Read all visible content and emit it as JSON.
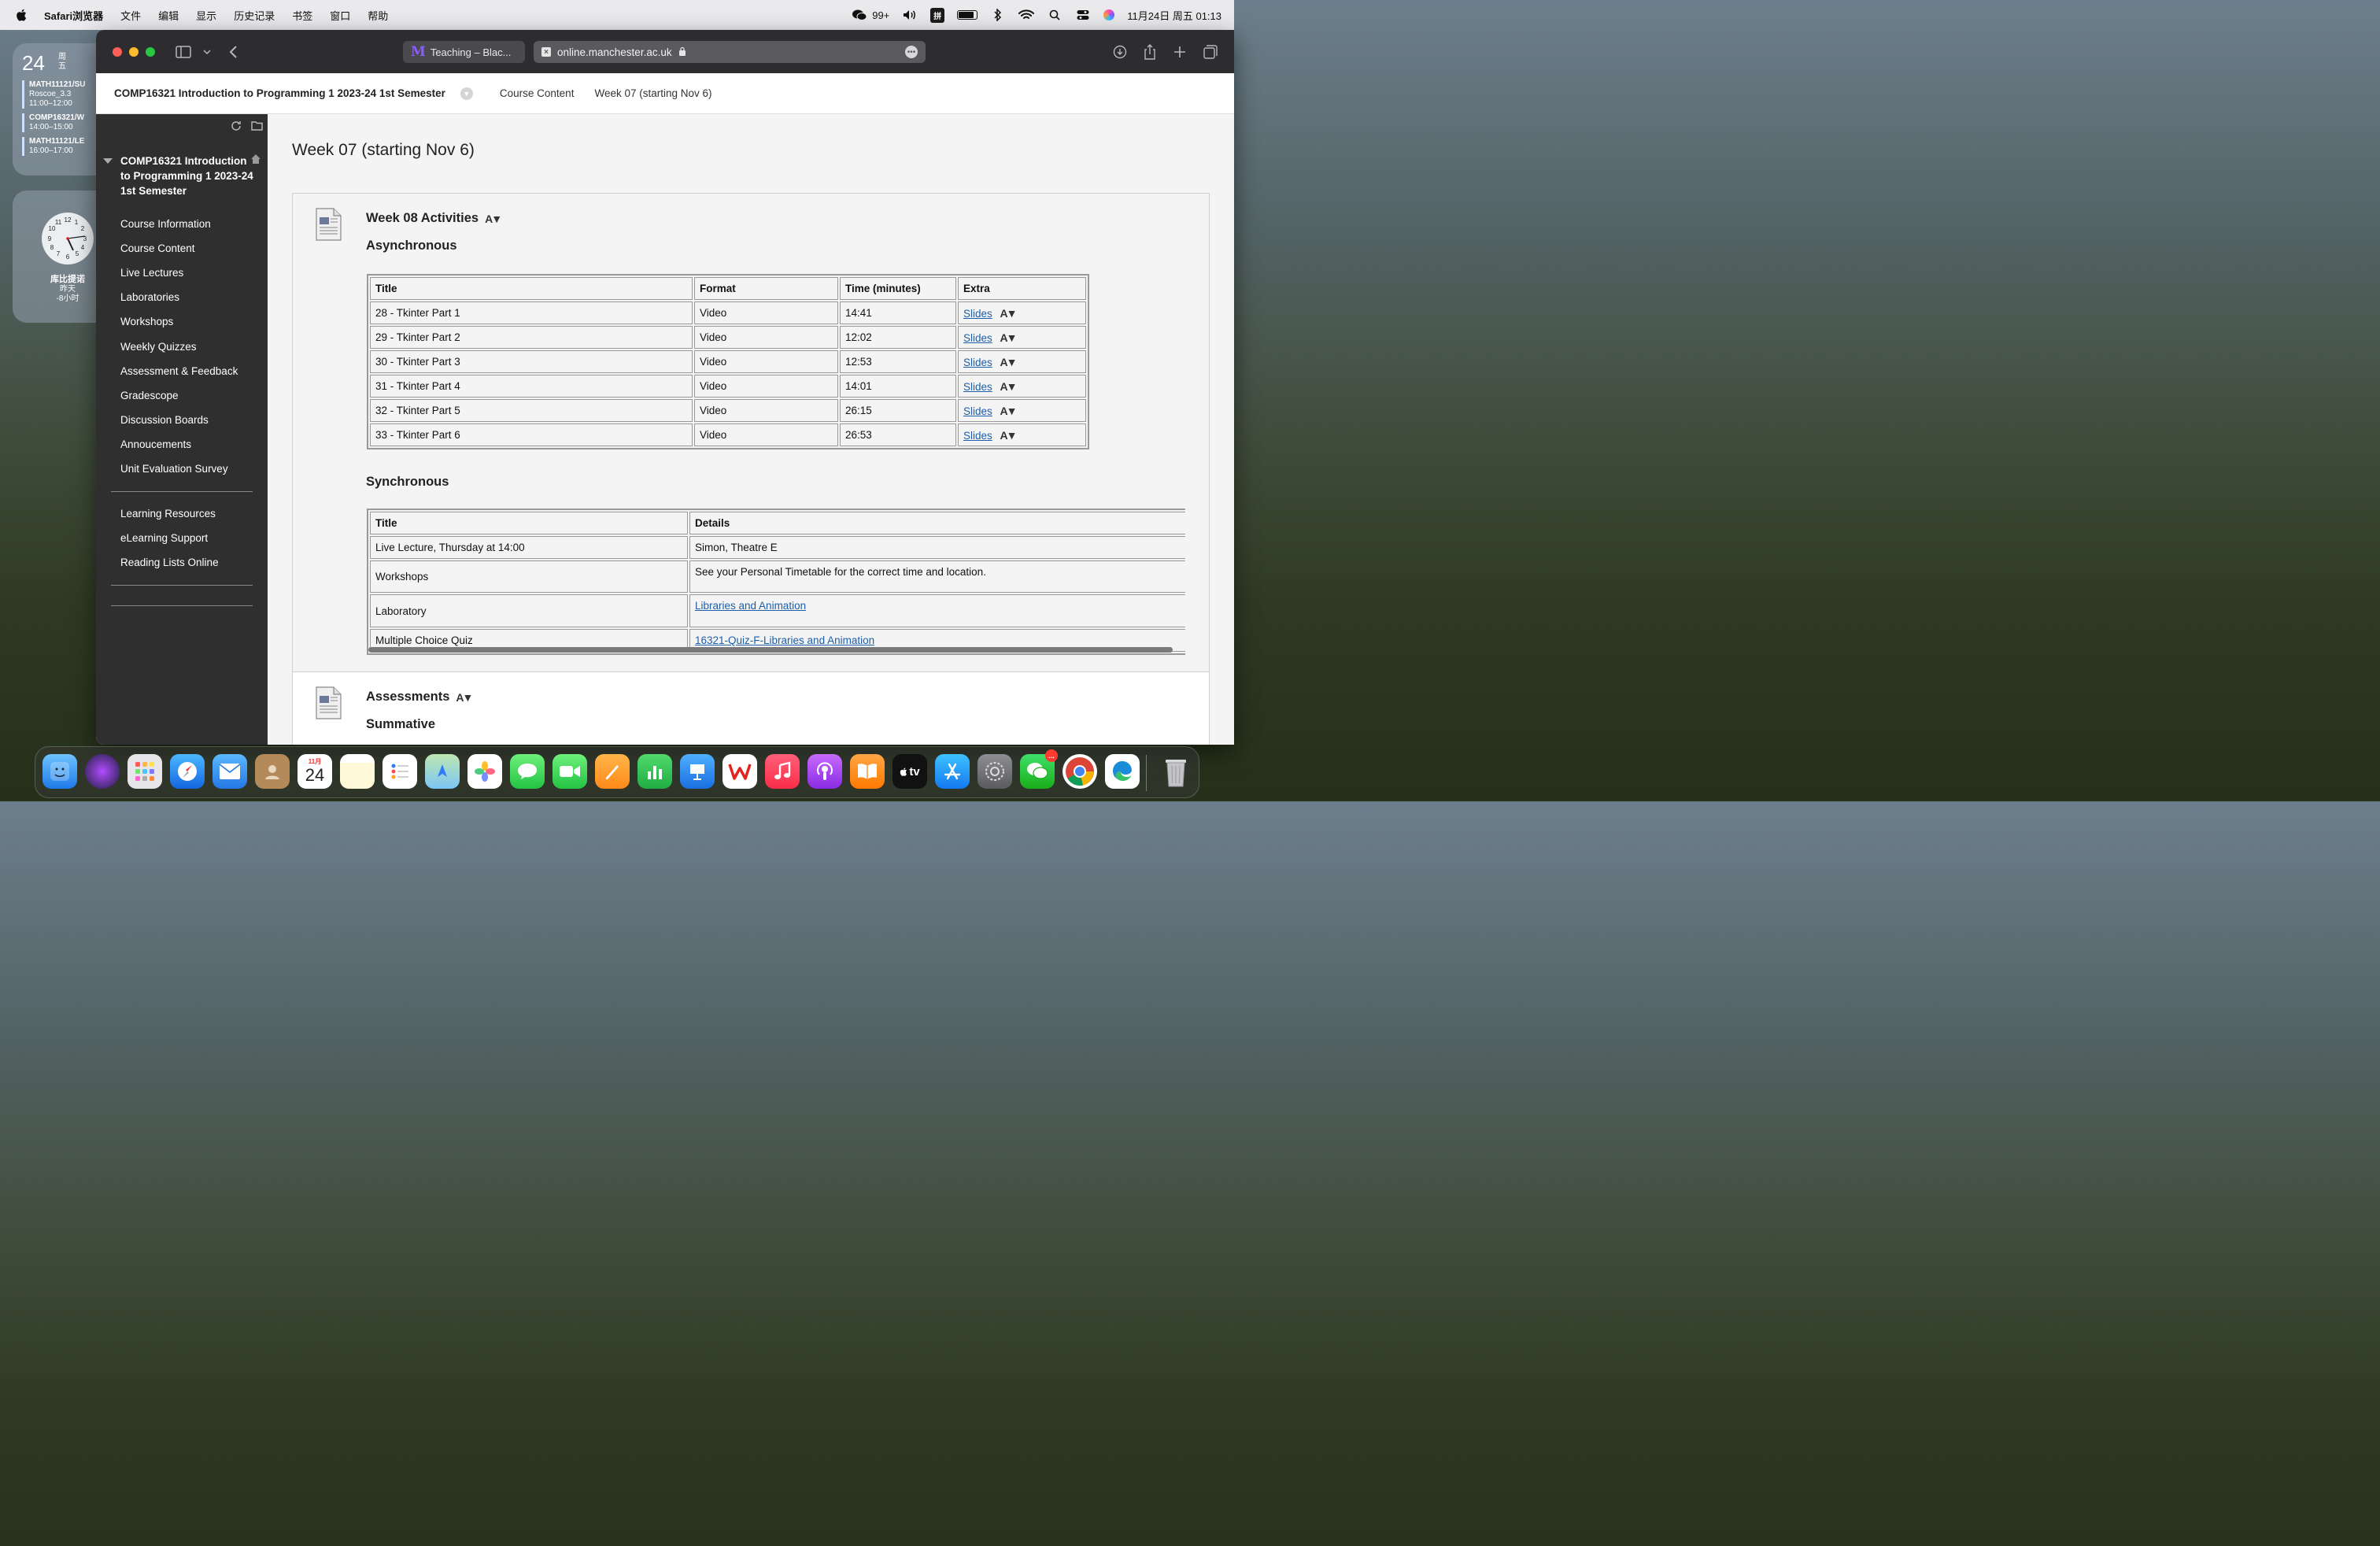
{
  "menubar": {
    "app_name": "Safari浏览器",
    "menus": [
      "文件",
      "编辑",
      "显示",
      "历史记录",
      "书签",
      "窗口",
      "帮助"
    ],
    "wechat_count": "99+",
    "ime_label": "拼",
    "datetime": "11月24日 周五 01:13"
  },
  "calendar_widget": {
    "day": "24",
    "weekday": "周五",
    "events": [
      {
        "title": "MATH11121/SU",
        "location": "Roscoe_3.3",
        "time": "11:00–12:00"
      },
      {
        "title": "COMP16321/W",
        "location": "",
        "time": "14:00–15:00"
      },
      {
        "title": "MATH11121/LE",
        "location": "",
        "time": "16:00–17:00"
      }
    ]
  },
  "clock_widget": {
    "city": "库比提诺",
    "day": "昨天",
    "offset": "-8小时",
    "numbers": [
      "12",
      "1",
      "2",
      "3",
      "4",
      "5",
      "6",
      "7",
      "8",
      "9",
      "10",
      "11"
    ]
  },
  "browser": {
    "tab_title": "Teaching – Blac...",
    "address": "online.manchester.ac.uk"
  },
  "header": {
    "course_title": "COMP16321 Introduction to Programming 1 2023-24 1st Semester",
    "breadcrumb_1": "Course Content",
    "breadcrumb_2": "Week 07 (starting Nov 6)"
  },
  "sidebar": {
    "course_name": "COMP16321 Introduction to Programming 1 2023-24 1st Semester",
    "items": [
      {
        "label": "Course Information"
      },
      {
        "label": "Course Content"
      },
      {
        "label": "Live Lectures"
      },
      {
        "label": "Laboratories"
      },
      {
        "label": "Workshops"
      },
      {
        "label": "Weekly Quizzes"
      },
      {
        "label": "Assessment & Feedback"
      },
      {
        "label": "Gradescope"
      },
      {
        "label": "Discussion Boards"
      },
      {
        "label": "Annoucements"
      },
      {
        "label": "Unit Evaluation Survey"
      }
    ],
    "secondary_items": [
      {
        "label": "Learning Resources"
      },
      {
        "label": "eLearning Support"
      },
      {
        "label": "Reading Lists Online"
      }
    ]
  },
  "main": {
    "page_title": "Week 07 (starting Nov 6)",
    "item1": {
      "title": "Week 08 Activities",
      "async_heading": "Asynchronous",
      "async_columns": [
        "Title",
        "Format",
        "Time (minutes)",
        "Extra"
      ],
      "async_rows": [
        {
          "title": "28 - Tkinter Part 1",
          "format": "Video",
          "time": "14:41",
          "extra": "Slides"
        },
        {
          "title": "29 - Tkinter Part 2",
          "format": "Video",
          "time": "12:02",
          "extra": "Slides"
        },
        {
          "title": "30 - Tkinter Part 3",
          "format": "Video",
          "time": "12:53",
          "extra": "Slides"
        },
        {
          "title": "31 - Tkinter Part 4",
          "format": "Video",
          "time": "14:01",
          "extra": "Slides"
        },
        {
          "title": "32 - Tkinter Part 5",
          "format": "Video",
          "time": "26:15",
          "extra": "Slides"
        },
        {
          "title": "33 - Tkinter Part 6",
          "format": "Video",
          "time": "26:53",
          "extra": "Slides"
        }
      ],
      "sync_heading": "Synchronous",
      "sync_columns": [
        "Title",
        "Details"
      ],
      "sync_rows": [
        {
          "title": "Live Lecture, Thursday at 14:00",
          "details": "Simon, Theatre E"
        },
        {
          "title": "Workshops",
          "details": "See your Personal Timetable for the correct time and location."
        },
        {
          "title": "Laboratory",
          "details": "Libraries and Animation"
        },
        {
          "title": "Multiple Choice Quiz",
          "details": "16321-Quiz-F-Libraries and Animation"
        }
      ]
    },
    "item2": {
      "title": "Assessments",
      "sub_heading": "Summative"
    }
  },
  "dock": {
    "calendar_month": "11月",
    "calendar_day": "24",
    "tv_label": "tv",
    "wechat_badge": "..."
  },
  "colors": {
    "link": "#1d5ea8",
    "sidebar_bg": "#2f2f2f",
    "toolbar_bg": "#2d2d30"
  }
}
